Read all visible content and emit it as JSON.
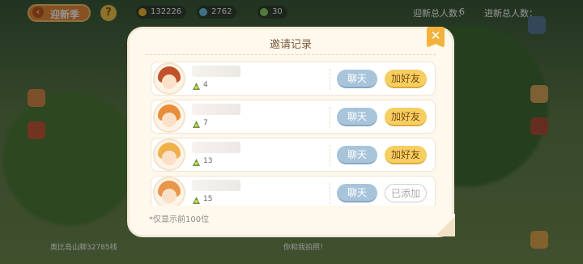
{
  "topbar": {
    "back_label": "迎新季",
    "help_label": "?",
    "resources": [
      "132226",
      "2762",
      "30"
    ],
    "new_people_label": "迎新总人数：",
    "new_people_value": "6",
    "progress_label": "进新总人数："
  },
  "modal": {
    "title": "邀请记录",
    "close_label": "✕",
    "note": "*仅显示前100位"
  },
  "invites": [
    {
      "level": "4",
      "chat_label": "聊天",
      "friend_label": "加好友",
      "added": false,
      "hair_color": "#c0522a"
    },
    {
      "level": "7",
      "chat_label": "聊天",
      "friend_label": "加好友",
      "added": false,
      "hair_color": "#e88d3a"
    },
    {
      "level": "13",
      "chat_label": "聊天",
      "friend_label": "加好友",
      "added": false,
      "hair_color": "#f0b04a"
    },
    {
      "level": "15",
      "chat_label": "聊天",
      "friend_label": "已添加",
      "added": true,
      "hair_color": "#e8964a"
    }
  ],
  "bottom": {
    "left_text": "奥比岛山脚32785线",
    "mid_text": "你和我拍照！"
  },
  "colors": {
    "chat_button": "#a8c4db",
    "add_button": "#f6cf62",
    "modal_bg": "#fff8ec",
    "close_button": "#f2b33d"
  }
}
